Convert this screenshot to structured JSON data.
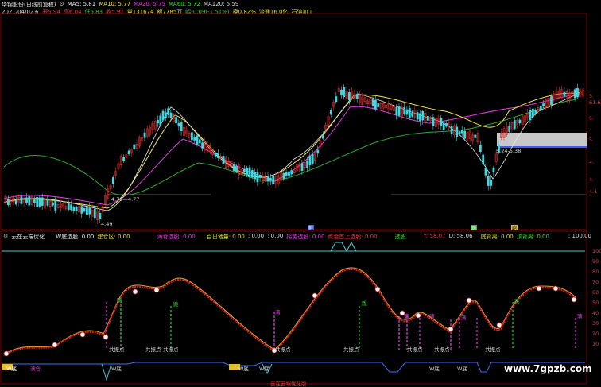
{
  "header1": {
    "title": "华锦股份(日线前复权)",
    "ma5": "MA5: 5.81",
    "ma10": "MA10: 5.77",
    "ma20": "MA20: 5.75",
    "ma60": "MA60: 5.72",
    "ma120": "MA120: 5.59"
  },
  "header2": {
    "date": "2021/04/02五",
    "open": "开5.94",
    "high": "高6.04",
    "low": "低5.83",
    "close": "收5.97",
    "volume": "量131674",
    "amount": "额7785万",
    "change": "幅-0.09(-1.51%)",
    "turnover": "换0.82%",
    "float": "流通16.0亿",
    "sector": "石油加工"
  },
  "price_labels": {
    "low_449": "4.49",
    "ann_477": "4.79—4.77",
    "ann_538": "5.24-5.38"
  },
  "right_axis_top": [
    "5",
    "61.6",
    "5.",
    "5",
    "4.",
    "4.",
    "4.1"
  ],
  "markers": {
    "top_marker": "鲜",
    "mid_marker_1": "踏",
    "mid_marker_2": "跑"
  },
  "indicator_header": {
    "name": "云在云端优化",
    "w_bottom": "W底选股: 0.00",
    "build": "建仓区: 0.00",
    "full_position": "满仓选股: 0.00",
    "hundred_day": "百日地量: 0.00",
    "val2": ": 0.00",
    "val3": ": 0.00",
    "trend_pick": "摇势选股: 0.00",
    "main_up": "資金首上选股: 0.00",
    "select": "选股",
    "y": "Y: 58.07",
    "d": "D: 58.06",
    "bottom_back": "底背离: 0.00",
    "top_back": "顶背离: 0.00",
    "hundred": ": 100.00"
  },
  "right_axis_bottom": [
    "100",
    "90",
    "80",
    "70",
    "60",
    "50",
    "40",
    "30",
    "20",
    "10"
  ],
  "signals": {
    "full": "满",
    "jump": "跳",
    "common_shake": "共振点",
    "w_bottom": "W底",
    "buy": "买点",
    "full_cang": "满仓"
  },
  "watermark": "www.7gpzb.com",
  "bottom_note": "云在云端优化版"
}
